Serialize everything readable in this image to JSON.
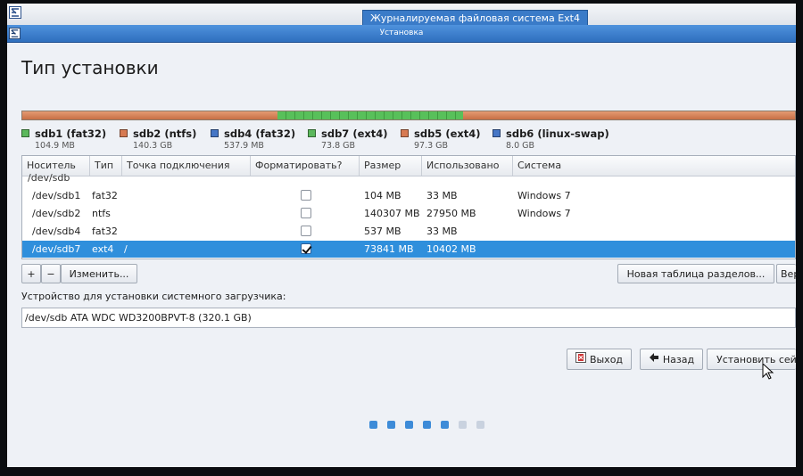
{
  "window": {
    "outer_tooltip": "Журналируемая файловая система Ext4",
    "inner_title": "Установка",
    "app_icon": "installer-icon"
  },
  "page": {
    "title": "Тип установки"
  },
  "colors": {
    "fat32": "#5bb85c",
    "ntfs": "#d77a52",
    "ext4_green": "#5bb85c",
    "ext4_orange": "#d77a52",
    "swap": "#4576c6",
    "selection": "#2f8fdc"
  },
  "partition_bar": [
    {
      "name": "sdb1",
      "color": "orange",
      "fraction": 0.33
    },
    {
      "name": "sdb7",
      "color": "green",
      "fraction": 0.24
    },
    {
      "name": "sdb5",
      "color": "orange",
      "fraction": 0.43
    }
  ],
  "legend": [
    {
      "name": "sdb1 (fat32)",
      "size": "104.9 MB",
      "color": "#5bb85c"
    },
    {
      "name": "sdb2 (ntfs)",
      "size": "140.3 GB",
      "color": "#d77a52"
    },
    {
      "name": "sdb4 (fat32)",
      "size": "537.9 MB",
      "color": "#4576c6"
    },
    {
      "name": "sdb7 (ext4)",
      "size": "73.8 GB",
      "color": "#5bb85c"
    },
    {
      "name": "sdb5 (ext4)",
      "size": "97.3 GB",
      "color": "#d77a52"
    },
    {
      "name": "sdb6 (linux-swap)",
      "size": "8.0 GB",
      "color": "#4576c6"
    }
  ],
  "table": {
    "headers": [
      "Носитель",
      "Тип",
      "Точка подключения",
      "Форматировать?",
      "Размер",
      "Использовано",
      "Система"
    ],
    "drive": "/dev/sdb",
    "rows": [
      {
        "device": "/dev/sdb1",
        "type": "fat32",
        "mount": "",
        "format": false,
        "size": "104 MB",
        "used": "33 MB",
        "system": "Windows 7",
        "selected": false
      },
      {
        "device": "/dev/sdb2",
        "type": "ntfs",
        "mount": "",
        "format": false,
        "size": "140307 MB",
        "used": "27950 MB",
        "system": "Windows 7",
        "selected": false
      },
      {
        "device": "/dev/sdb4",
        "type": "fat32",
        "mount": "",
        "format": false,
        "size": "537 MB",
        "used": "33 MB",
        "system": "",
        "selected": false
      },
      {
        "device": "/dev/sdb7",
        "type": "ext4",
        "mount": "/",
        "format": true,
        "size": "73841 MB",
        "used": "10402 MB",
        "system": "",
        "selected": true
      }
    ]
  },
  "toolbar": {
    "add_label": "+",
    "remove_label": "−",
    "change_label": "Изменить...",
    "new_table_label": "Новая таблица разделов...",
    "revert_label": "Вер"
  },
  "bootloader": {
    "label": "Устройство для установки системного загрузчика:",
    "device": "/dev/sdb   ATA WDC WD3200BPVT-8 (320.1 GB)"
  },
  "nav": {
    "quit_label": "Выход",
    "back_label": "Назад",
    "install_label": "Установить сейчас"
  },
  "progress": {
    "steps_total": 7,
    "steps_done": 5
  }
}
